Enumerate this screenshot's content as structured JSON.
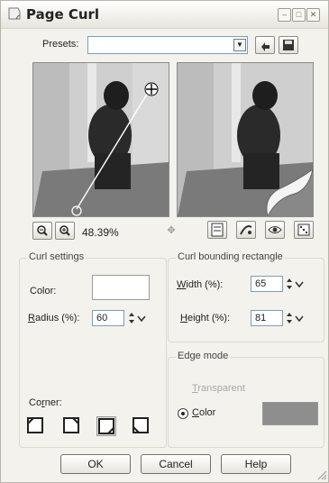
{
  "window": {
    "title": "Page Curl"
  },
  "presets": {
    "label": "Presets:",
    "value": ""
  },
  "zoom": {
    "level": "48.39%"
  },
  "curl_settings": {
    "group_title": "Curl settings",
    "color_label": "Color:",
    "radius_label": "Radius (%):",
    "radius_value": "60",
    "corner_label": "Corner:"
  },
  "bounding": {
    "group_title": "Curl bounding rectangle",
    "width_label": "Width (%):",
    "width_value": "65",
    "height_label": "Height (%):",
    "height_value": "81"
  },
  "edge_mode": {
    "group_title": "Edge mode",
    "transparent_label": "Transparent",
    "color_label": "Color",
    "selected": "Color"
  },
  "buttons": {
    "ok": "OK",
    "cancel": "Cancel",
    "help": "Help"
  },
  "colors": {
    "curl_color": "#ffffff",
    "edge_color": "#8e8e8e"
  }
}
